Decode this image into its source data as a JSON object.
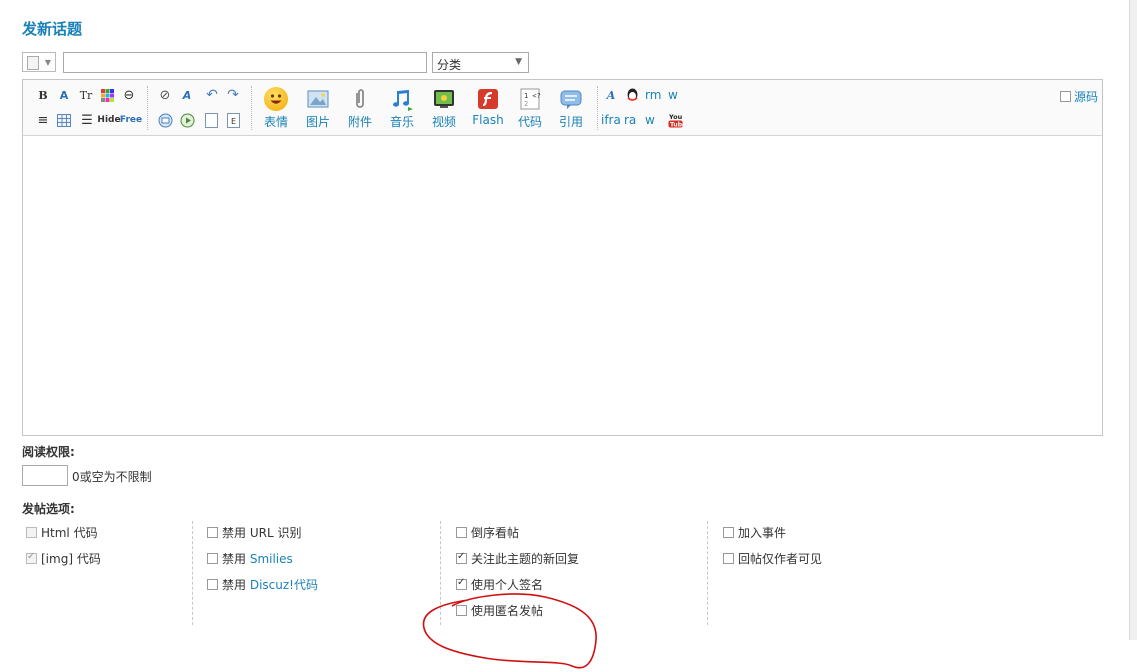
{
  "page": {
    "title": "发新话题"
  },
  "top_row": {
    "subject_value": "",
    "category_selected": "分类"
  },
  "toolbar": {
    "row1_icons": [
      "bold-icon",
      "font-icon",
      "font-size-icon",
      "color-icon",
      "link-icon",
      "unlink-icon",
      "remove-format-icon",
      "undo-icon",
      "redo-icon"
    ],
    "row2_icons": [
      "align-left-icon",
      "table-icon",
      "list-icon",
      "hide-icon",
      "free-icon",
      "insert-icon",
      "media-icon",
      "page-icon",
      "index-icon"
    ],
    "hide_label": "Hide",
    "free_label": "Free",
    "big_buttons": [
      {
        "name": "smiley",
        "label": "表情",
        "color": "#f5b300"
      },
      {
        "name": "image",
        "label": "图片",
        "color": "#7aa9cf"
      },
      {
        "name": "attach",
        "label": "附件",
        "color": "#9a9a9a"
      },
      {
        "name": "music",
        "label": "音乐",
        "color": "#2a7fd4"
      },
      {
        "name": "video",
        "label": "视频",
        "color": "#5a9e3a"
      },
      {
        "name": "flash",
        "label": "Flash",
        "color": "#d53a2a"
      },
      {
        "name": "code",
        "label": "代码",
        "color": "#a0a0a0"
      },
      {
        "name": "quote",
        "label": "引用",
        "color": "#6ea2e0"
      }
    ],
    "extra_row1": [
      "rm",
      "w"
    ],
    "extra_row2": [
      "ifra",
      "ra",
      "w"
    ],
    "source_label": "源码"
  },
  "read_permission": {
    "label": "阅读权限:",
    "value": "",
    "hint": "0或空为不限制"
  },
  "post_options": {
    "label": "发帖选项:",
    "columns": [
      [
        {
          "text": "Html 代码",
          "checked": false,
          "disabled": true
        },
        {
          "text": "[img] 代码",
          "checked": true,
          "disabled": true
        }
      ],
      [
        {
          "prefix": "禁用 ",
          "text": "URL 识别",
          "highlight": false,
          "checked": false
        },
        {
          "prefix": "禁用 ",
          "text": "Smilies",
          "highlight": true,
          "checked": false
        },
        {
          "prefix": "禁用 ",
          "text": "Discuz!代码",
          "highlight": true,
          "checked": false
        }
      ],
      [
        {
          "text": "倒序看帖",
          "checked": false
        },
        {
          "text": "关注此主题的新回复",
          "checked": true
        },
        {
          "text": "使用个人签名",
          "checked": true
        },
        {
          "text": "使用匿名发帖",
          "checked": false
        }
      ],
      [
        {
          "text": "加入事件",
          "checked": false
        },
        {
          "text": "回帖仅作者可见",
          "checked": false
        }
      ]
    ]
  },
  "annotation": {
    "color": "#d01010"
  }
}
